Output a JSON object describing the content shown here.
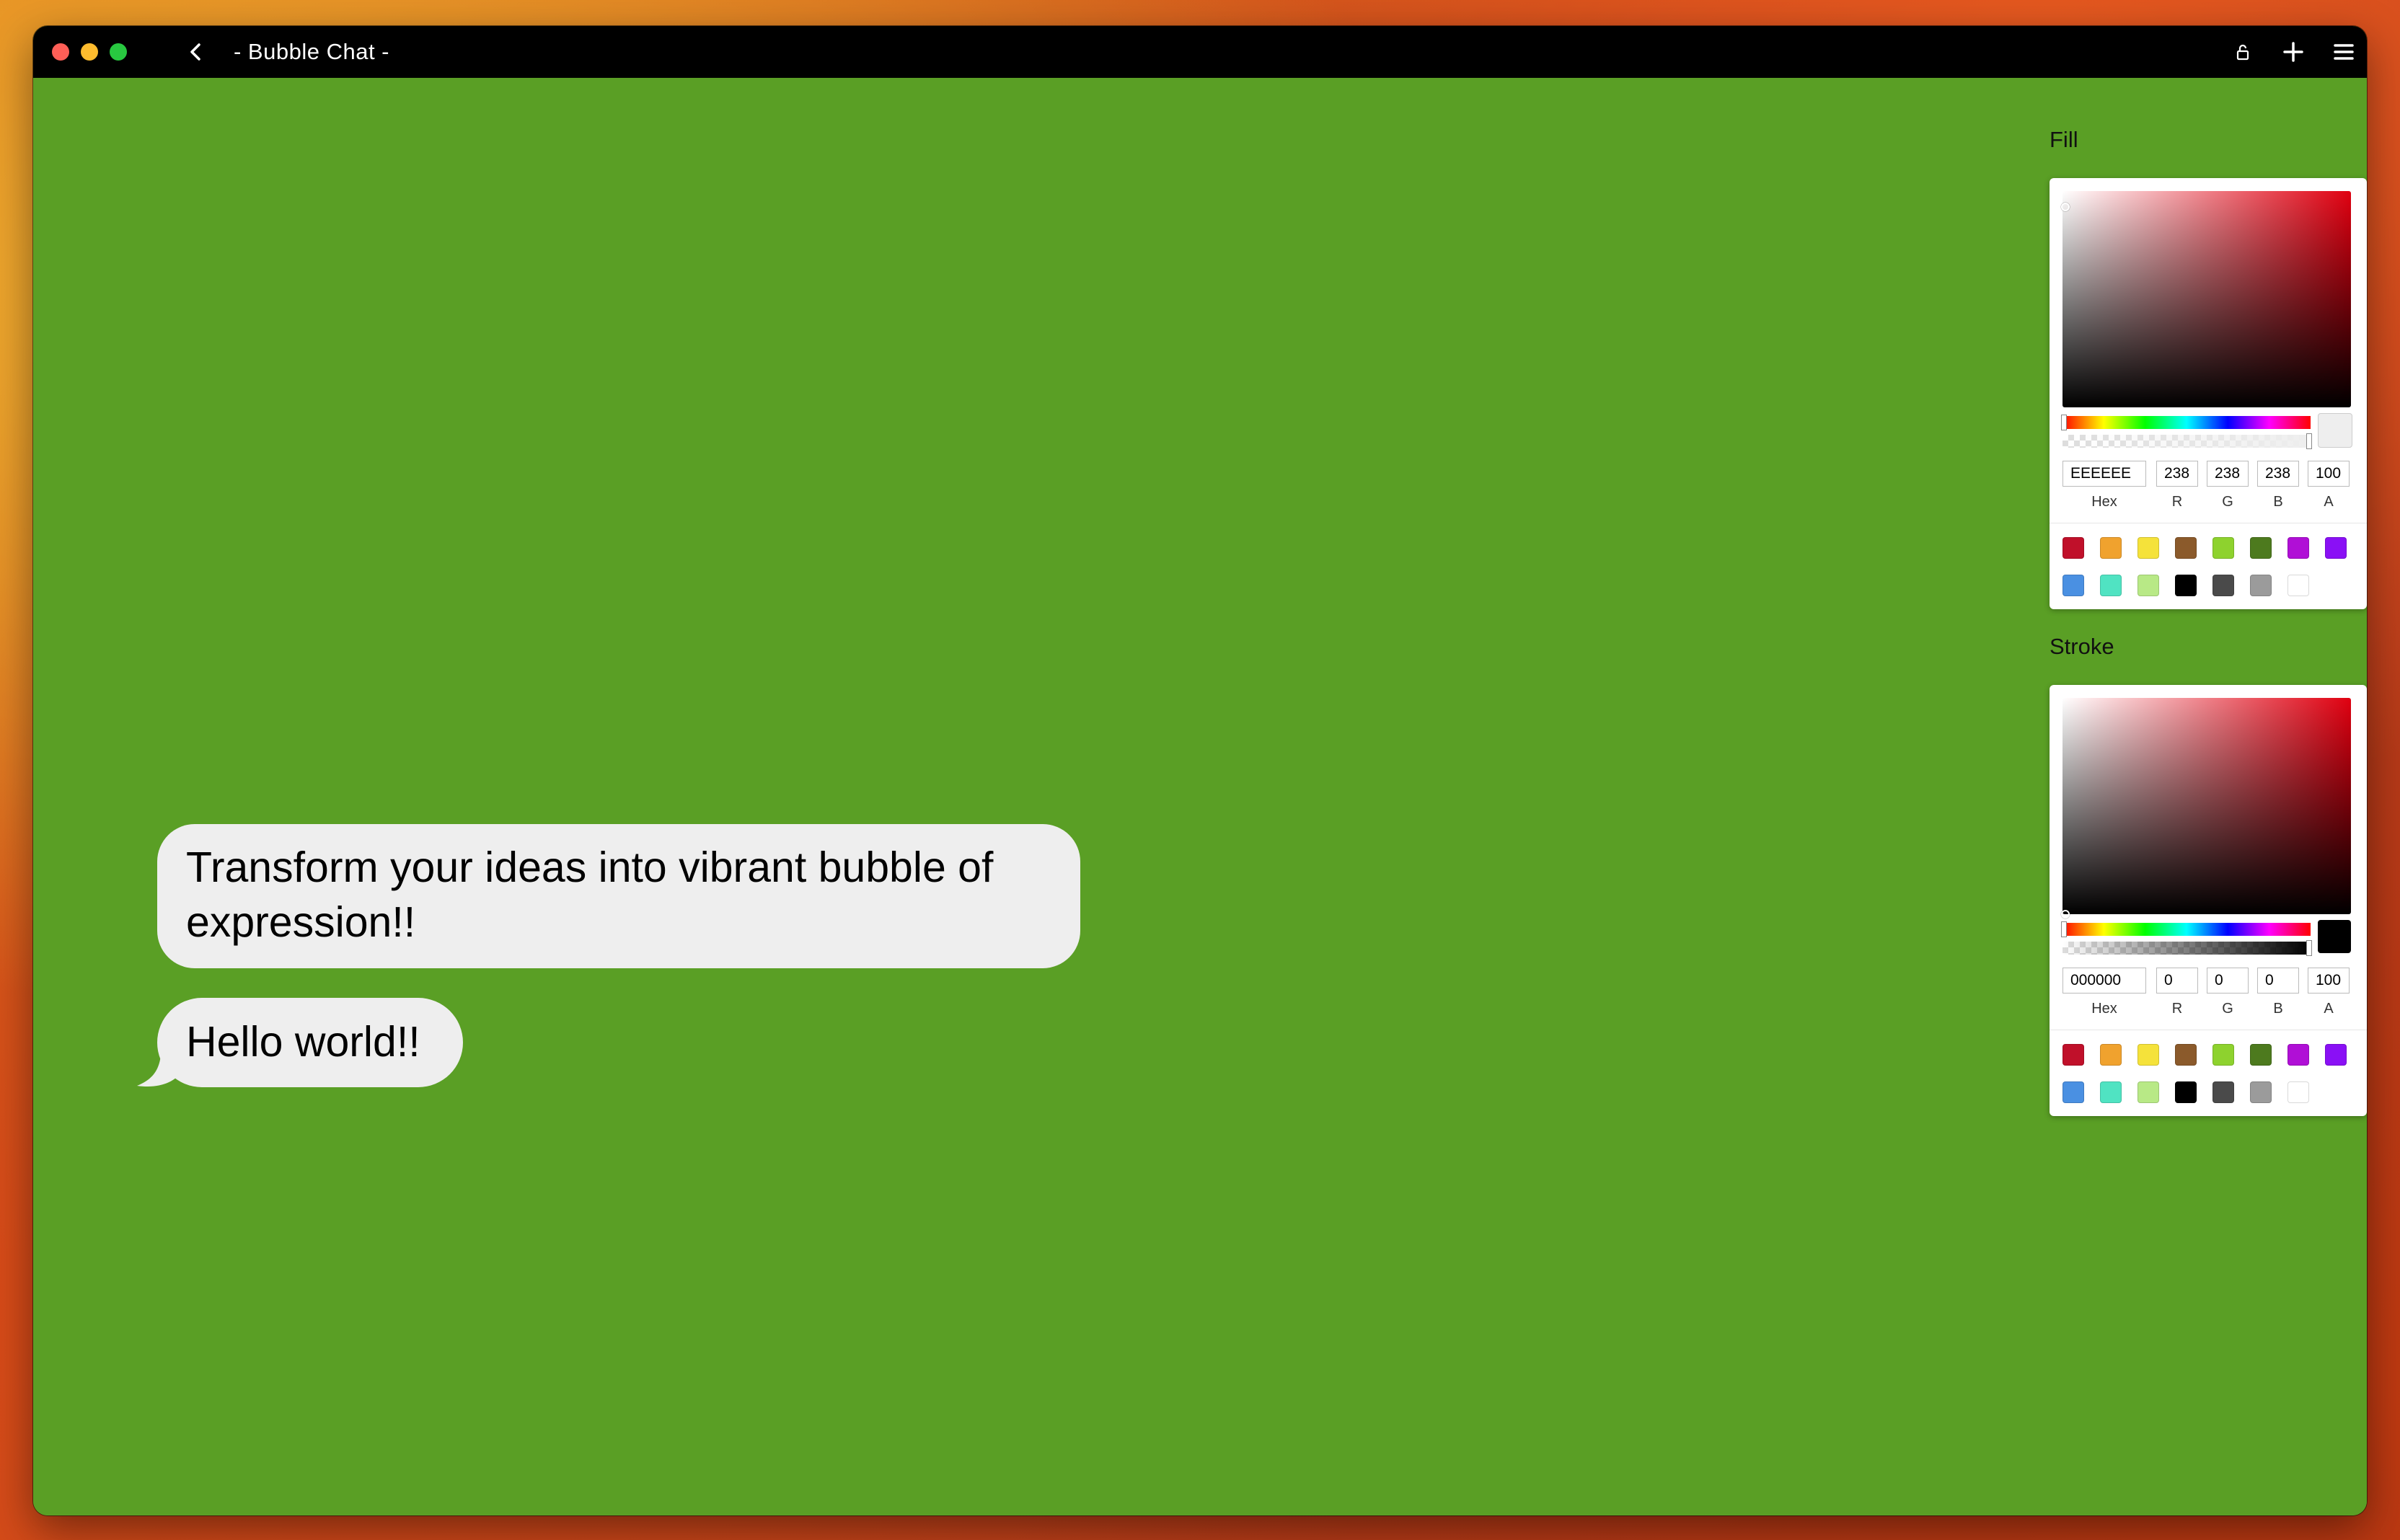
{
  "window": {
    "title": "- Bubble Chat -"
  },
  "canvas": {
    "background": "#5a9f25"
  },
  "bubbles": [
    {
      "text": "Transform your ideas into vibrant bubble of expression!!"
    },
    {
      "text": "Hello world!!"
    }
  ],
  "fill": {
    "label": "Fill",
    "hex": "EEEEEE",
    "r": "238",
    "g": "238",
    "b": "238",
    "a": "100",
    "labels": {
      "hex": "Hex",
      "r": "R",
      "g": "G",
      "b": "B",
      "a": "A"
    }
  },
  "stroke": {
    "label": "Stroke",
    "hex": "000000",
    "r": "0",
    "g": "0",
    "b": "0",
    "a": "100",
    "labels": {
      "hex": "Hex",
      "r": "R",
      "g": "G",
      "b": "B",
      "a": "A"
    }
  },
  "swatches": [
    "#c0102a",
    "#f0a22e",
    "#f5e23a",
    "#8b5a2b",
    "#8ed22e",
    "#4d7a1e",
    "#b00fd6",
    "#8a10f5",
    "#4a90e2",
    "#50e3c2",
    "#b8e986",
    "#000000",
    "#4a4a4a",
    "#9b9b9b",
    "#ffffff"
  ]
}
